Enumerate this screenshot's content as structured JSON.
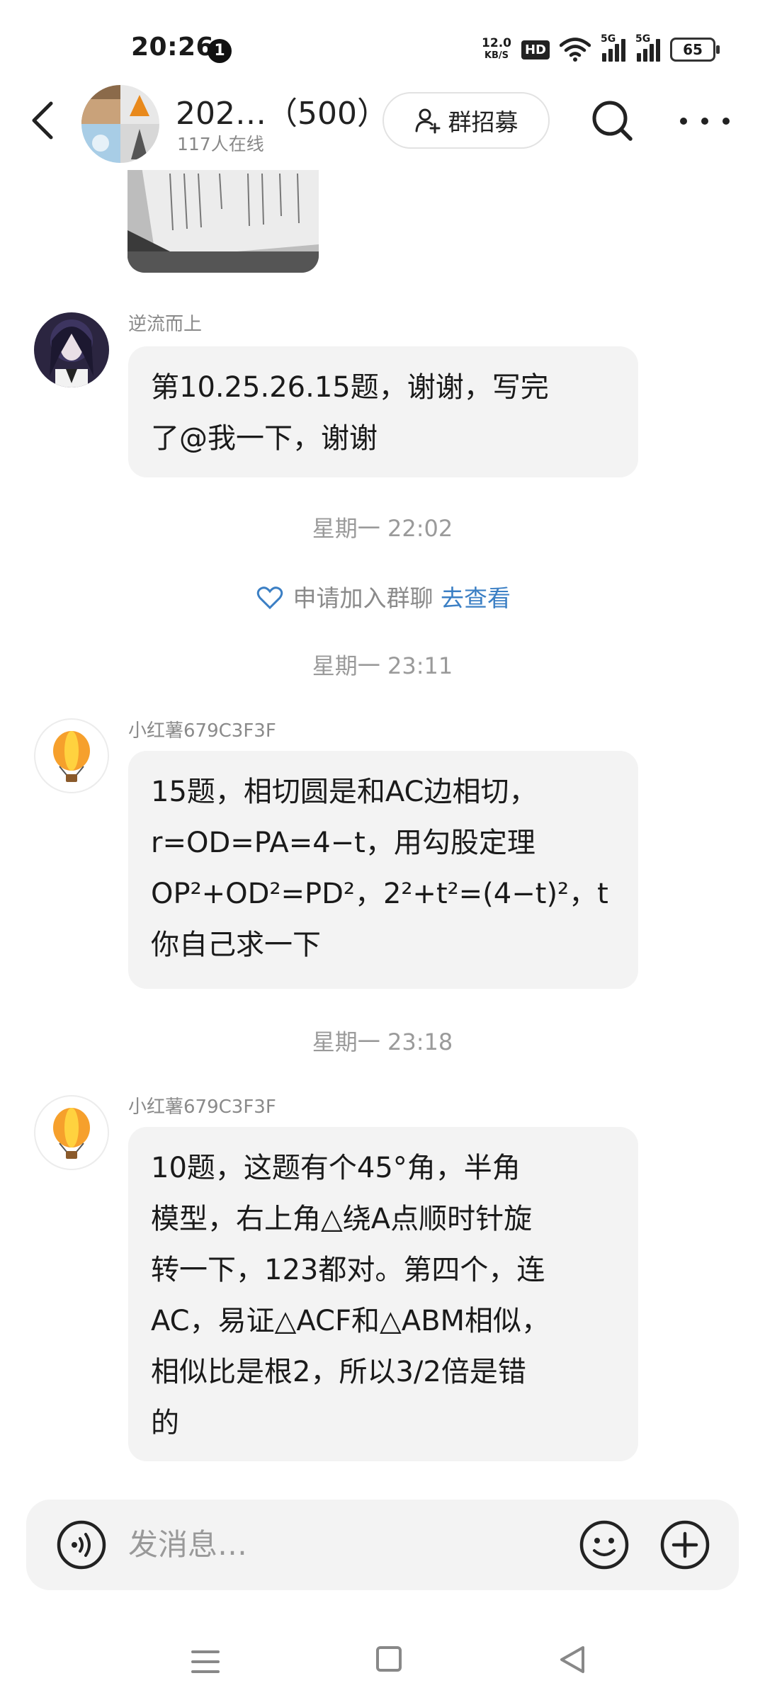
{
  "status_bar": {
    "time": "20:26",
    "notification_count": "1",
    "net_speed_value": "12.0",
    "net_speed_unit": "KB/S",
    "hd_label": "HD",
    "signal1_label": "5G",
    "signal2_label": "5G",
    "battery": "65"
  },
  "header": {
    "group_title": "202…（500）",
    "online_count": "117人在线",
    "recruit_label": "群招募",
    "icons": [
      "back-arrow-icon",
      "search-icon",
      "more-dots-icon",
      "add-person-icon"
    ]
  },
  "messages": [
    {
      "sender": "逆流而上",
      "text": "第10.25.26.15题，谢谢，写完\n了@我一下，谢谢"
    },
    {
      "sender": "小红薯679C3F3F",
      "text": "15题，相切圆是和AC边相切，\nr=OD=PA=4−t，用勾股定理\nOP²+OD²=PD²，2²+t²=(4−t)²，t\n你自己求一下"
    },
    {
      "sender": "小红薯679C3F3F",
      "text": "10题，这题有个45°角，半角\n模型，右上角△绕A点顺时针旋\n转一下，123都对。第四个，连\nAC，易证△ACF和△ABM相似，\n相似比是根2，所以3/2倍是错\n的"
    }
  ],
  "timestamps": [
    "星期一 22:02",
    "星期一 23:11",
    "星期一 23:18"
  ],
  "system_notice": {
    "text": "申请加入群聊",
    "link": "去查看"
  },
  "input_bar": {
    "placeholder": "发消息…"
  },
  "colors": {
    "bubble_bg": "#f3f3f3",
    "link_blue": "#3b7fc4",
    "balloon_orange": "#f6a02c",
    "balloon_yellow": "#ffd23f"
  }
}
